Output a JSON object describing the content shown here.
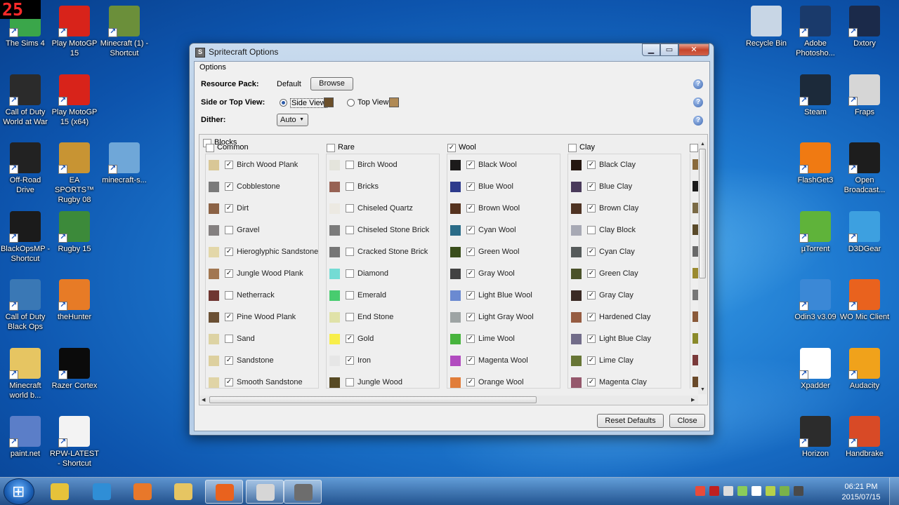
{
  "desktop": {
    "fps_counter": "25",
    "left_icons": [
      {
        "label": "The Sims 4",
        "icon": "sims-icon",
        "color": "#3aa64a"
      },
      {
        "label": "Play MotoGP 15",
        "icon": "motogp-icon",
        "color": "#d8231a"
      },
      {
        "label": "Minecraft (1) - Shortcut",
        "icon": "minecraft-icon",
        "color": "#6b8f3a"
      },
      {
        "label": "Call of Duty World at War",
        "icon": "cod-waw-icon",
        "color": "#2b2b2b"
      },
      {
        "label": "Play MotoGP 15 (x64)",
        "icon": "motogp-x64-icon",
        "color": "#d8231a"
      },
      {
        "label": "Off-Road Drive",
        "icon": "offroad-icon",
        "color": "#222222"
      },
      {
        "label": "EA SPORTS™ Rugby 08",
        "icon": "rugby08-icon",
        "color": "#c89433"
      },
      {
        "label": "minecraft-s...",
        "icon": "image-file-icon",
        "color": "#6fa7d8"
      },
      {
        "label": "BlackOpsMP - Shortcut",
        "icon": "blackops-mp-icon",
        "color": "#1b1b1b"
      },
      {
        "label": "Rugby 15",
        "icon": "rugby15-icon",
        "color": "#3c8a3a"
      },
      {
        "label": "Call of Duty Black Ops",
        "icon": "blackops-icon",
        "color": "#3a78b5"
      },
      {
        "label": "theHunter",
        "icon": "thehunter-icon",
        "color": "#e77b26"
      },
      {
        "label": "Minecraft world b...",
        "icon": "folder-icon",
        "color": "#e6c562"
      },
      {
        "label": "Razer Cortex",
        "icon": "razer-icon",
        "color": "#0b0b0b"
      },
      {
        "label": "paint.net",
        "icon": "paintnet-icon",
        "color": "#5b7ec8"
      },
      {
        "label": "RPW-LATEST - Shortcut",
        "icon": "java-file-icon",
        "color": "#f3f3f3"
      }
    ],
    "right_icons": [
      {
        "label": "Recycle Bin",
        "icon": "recycle-bin-icon",
        "color": "#c8d6e5"
      },
      {
        "label": "Adobe Photosho...",
        "icon": "photoshop-icon",
        "color": "#1a3a6b"
      },
      {
        "label": "Dxtory",
        "icon": "dxtory-icon",
        "color": "#1b2a4a"
      },
      {
        "label": "Steam",
        "icon": "steam-icon",
        "color": "#1c2a3a"
      },
      {
        "label": "Fraps",
        "icon": "fraps-icon",
        "color": "#d6d6d6"
      },
      {
        "label": "FlashGet3",
        "icon": "flashget-icon",
        "color": "#f07a12"
      },
      {
        "label": "Open Broadcast...",
        "icon": "obs-icon",
        "color": "#1d1d1d"
      },
      {
        "label": "µTorrent",
        "icon": "utorrent-icon",
        "color": "#5fb33a"
      },
      {
        "label": "D3DGear",
        "icon": "d3dgear-icon",
        "color": "#3da0e0"
      },
      {
        "label": "Odin3 v3.09",
        "icon": "odin-icon",
        "color": "#3b88d6"
      },
      {
        "label": "WO Mic Client",
        "icon": "womic-icon",
        "color": "#e9621e"
      },
      {
        "label": "Xpadder",
        "icon": "xpadder-icon",
        "color": "#ffffff"
      },
      {
        "label": "Audacity",
        "icon": "audacity-icon",
        "color": "#f0a21b"
      },
      {
        "label": "Horizon",
        "icon": "horizon-icon",
        "color": "#2c2c2c"
      },
      {
        "label": "Handbrake",
        "icon": "handbrake-icon",
        "color": "#d84a26"
      }
    ]
  },
  "window": {
    "title": "Spritecraft Options",
    "minimize": "▁",
    "maximize": "▭",
    "close": "✕",
    "group_label": "Options",
    "resource_pack_label": "Resource Pack:",
    "resource_pack_value": "Default",
    "browse_label": "Browse",
    "view_label": "Side or Top View:",
    "side_view_label": "Side View",
    "top_view_label": "Top View",
    "dither_label": "Dither:",
    "dither_value": "Auto",
    "help_glyph": "?",
    "blocks_label": "Blocks",
    "reset_label": "Reset Defaults",
    "close_label": "Close"
  },
  "columns": [
    {
      "title": "Common",
      "checked": false,
      "items": [
        {
          "name": "Birch Wood Plank",
          "checked": true,
          "color": "#d9c796"
        },
        {
          "name": "Cobblestone",
          "checked": true,
          "color": "#7a7a7a"
        },
        {
          "name": "Dirt",
          "checked": true,
          "color": "#8b6245"
        },
        {
          "name": "Gravel",
          "checked": false,
          "color": "#848080"
        },
        {
          "name": "Hieroglyphic Sandstone",
          "checked": true,
          "color": "#e3d7a9"
        },
        {
          "name": "Jungle Wood Plank",
          "checked": true,
          "color": "#a27751"
        },
        {
          "name": "Netherrack",
          "checked": false,
          "color": "#6f3631"
        },
        {
          "name": "Pine Wood Plank",
          "checked": true,
          "color": "#6b5034"
        },
        {
          "name": "Sand",
          "checked": false,
          "color": "#ddd3a4"
        },
        {
          "name": "Sandstone",
          "checked": true,
          "color": "#ddd09f"
        },
        {
          "name": "Smooth Sandstone",
          "checked": true,
          "color": "#e0d4a6"
        }
      ]
    },
    {
      "title": "Rare",
      "checked": false,
      "items": [
        {
          "name": "Birch Wood",
          "checked": false,
          "color": "#e4e4dc"
        },
        {
          "name": "Bricks",
          "checked": false,
          "color": "#976254"
        },
        {
          "name": "Chiseled Quartz",
          "checked": false,
          "color": "#ece9e2"
        },
        {
          "name": "Chiseled Stone Brick",
          "checked": false,
          "color": "#7b7b7b"
        },
        {
          "name": "Cracked Stone Brick",
          "checked": false,
          "color": "#767676"
        },
        {
          "name": "Diamond",
          "checked": false,
          "color": "#74dbd4"
        },
        {
          "name": "Emerald",
          "checked": false,
          "color": "#48cc6f"
        },
        {
          "name": "End Stone",
          "checked": false,
          "color": "#e0e2a8"
        },
        {
          "name": "Gold",
          "checked": true,
          "color": "#f8ee4a"
        },
        {
          "name": "Iron",
          "checked": true,
          "color": "#e6e6e6"
        },
        {
          "name": "Jungle Wood",
          "checked": false,
          "color": "#574a24"
        }
      ]
    },
    {
      "title": "Wool",
      "checked": true,
      "items": [
        {
          "name": "Black Wool",
          "checked": true,
          "color": "#1c1a1a"
        },
        {
          "name": "Blue Wool",
          "checked": true,
          "color": "#2e3b8c"
        },
        {
          "name": "Brown Wool",
          "checked": true,
          "color": "#55321e"
        },
        {
          "name": "Cyan Wool",
          "checked": true,
          "color": "#2a6b87"
        },
        {
          "name": "Green Wool",
          "checked": true,
          "color": "#3a4e1c"
        },
        {
          "name": "Gray Wool",
          "checked": true,
          "color": "#424242"
        },
        {
          "name": "Light Blue Wool",
          "checked": true,
          "color": "#6b8ad1"
        },
        {
          "name": "Light Gray Wool",
          "checked": true,
          "color": "#9ea4a4"
        },
        {
          "name": "Lime Wool",
          "checked": true,
          "color": "#47b33d"
        },
        {
          "name": "Magenta Wool",
          "checked": true,
          "color": "#b14bbf"
        },
        {
          "name": "Orange Wool",
          "checked": true,
          "color": "#e17d3a"
        }
      ]
    },
    {
      "title": "Clay",
      "checked": false,
      "items": [
        {
          "name": "Black Clay",
          "checked": true,
          "color": "#251710"
        },
        {
          "name": "Blue Clay",
          "checked": true,
          "color": "#4a3b5b"
        },
        {
          "name": "Brown Clay",
          "checked": true,
          "color": "#4e3323"
        },
        {
          "name": "Clay Block",
          "checked": false,
          "color": "#a7a9b4"
        },
        {
          "name": "Cyan Clay",
          "checked": true,
          "color": "#565b5b"
        },
        {
          "name": "Green Clay",
          "checked": true,
          "color": "#4b522a"
        },
        {
          "name": "Gray Clay",
          "checked": true,
          "color": "#3a2a24"
        },
        {
          "name": "Hardened Clay",
          "checked": true,
          "color": "#965c42"
        },
        {
          "name": "Light Blue Clay",
          "checked": true,
          "color": "#716c89"
        },
        {
          "name": "Lime Clay",
          "checked": true,
          "color": "#677535"
        },
        {
          "name": "Magenta Clay",
          "checked": true,
          "color": "#95586c"
        }
      ]
    }
  ],
  "partial_column_colors": [
    "#8a6a3c",
    "#1a1a1a",
    "#7a6a45",
    "#5a4a2a",
    "#6a6a6a",
    "#9a8a30",
    "#777777",
    "#8a5a3a",
    "#8a8a2a",
    "#7a3a3a",
    "#6a4a2a"
  ],
  "taskbar": {
    "apps": [
      {
        "icon": "chrome-icon",
        "color": "#e6c23a"
      },
      {
        "icon": "ie-icon",
        "color": "#2f8ed6"
      },
      {
        "icon": "media-player-icon",
        "color": "#e8782a"
      },
      {
        "icon": "explorer-icon",
        "color": "#e6c562"
      },
      {
        "icon": "womic-taskbar-icon",
        "color": "#e9621e"
      },
      {
        "icon": "fraps-taskbar-icon",
        "color": "#d6d6d6"
      },
      {
        "icon": "spritecraft-taskbar-icon",
        "color": "#6d6d6d"
      }
    ],
    "tray_colors": [
      "#e84b3a",
      "#c02020",
      "#dddddd",
      "#8acc5a",
      "#ffffff",
      "#b6d14a",
      "#7ab24a",
      "#4a4a4a"
    ],
    "time": "06:21 PM",
    "date": "2015/07/15"
  }
}
